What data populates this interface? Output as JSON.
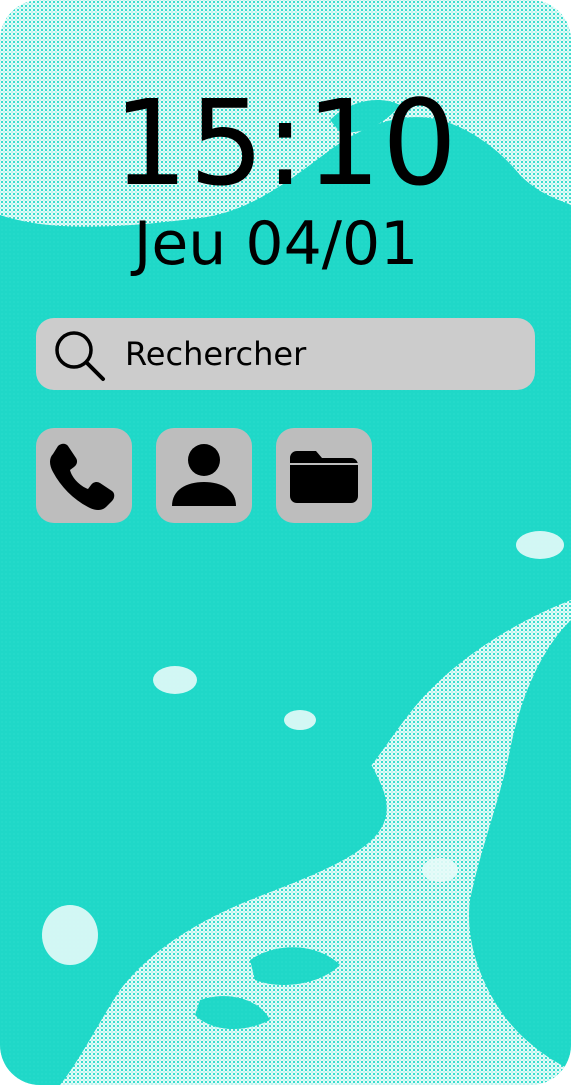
{
  "lock_screen": {
    "time": "15:10",
    "date": "Jeu 04/01"
  },
  "search": {
    "label": "Rechercher",
    "icon": "search-icon"
  },
  "apps": [
    {
      "icon": "phone-icon"
    },
    {
      "icon": "contacts-icon"
    },
    {
      "icon": "folder-icon"
    }
  ],
  "colors": {
    "wallpaper_accent": "#1fd8c8",
    "wallpaper_light": "#e6fbf8",
    "search_bg": "#cccccc",
    "app_bg": "#bdbdbd"
  }
}
